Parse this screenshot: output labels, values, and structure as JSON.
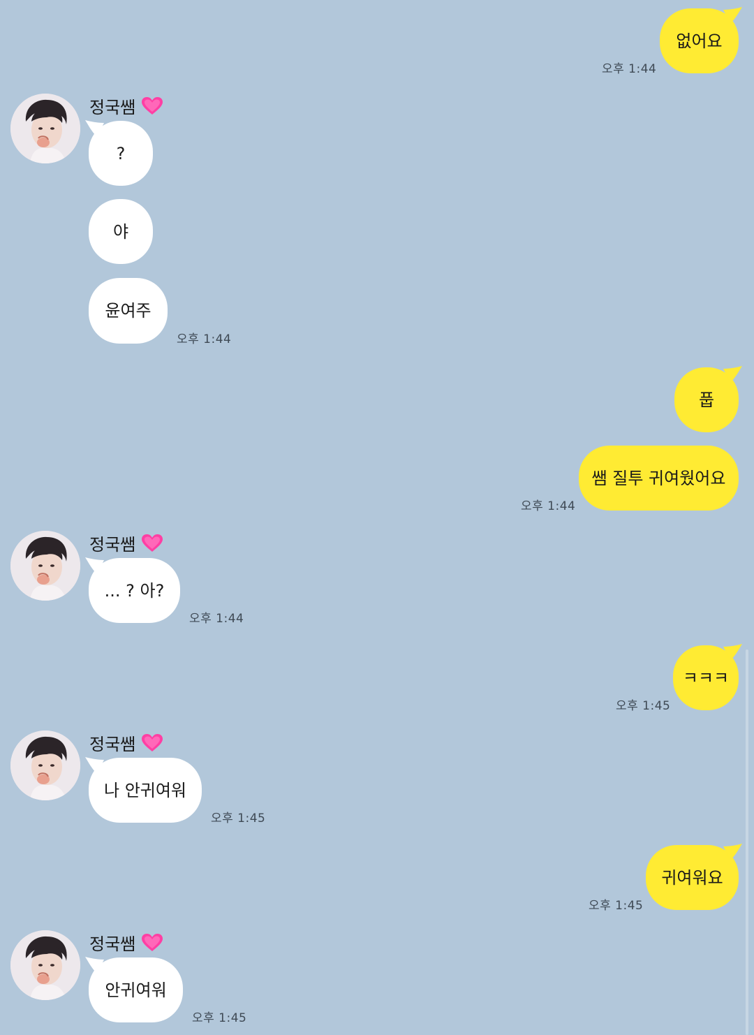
{
  "chat": {
    "contact_name": "정국쌤",
    "messages": [
      {
        "from": "me",
        "text": "없어요",
        "time": "오후 1:44"
      },
      {
        "from": "other",
        "text": "?"
      },
      {
        "from": "other",
        "text": "야"
      },
      {
        "from": "other",
        "text": "윤여주",
        "time": "오후 1:44"
      },
      {
        "from": "me",
        "text": "풉"
      },
      {
        "from": "me",
        "text": "쌤 질투 귀여웠어요",
        "time": "오후 1:44"
      },
      {
        "from": "other",
        "text": "... ? 아?",
        "time": "오후 1:44"
      },
      {
        "from": "me",
        "text": "ㅋㅋㅋ",
        "time": "오후 1:45"
      },
      {
        "from": "other",
        "text": "나 안귀여워",
        "time": "오후 1:45"
      },
      {
        "from": "me",
        "text": "귀여워요",
        "time": "오후 1:45"
      },
      {
        "from": "other",
        "text": "안귀여워",
        "time": "오후 1:45"
      }
    ]
  },
  "colors": {
    "background": "#b2c7da",
    "my_bubble": "#ffeb33",
    "their_bubble": "#ffffff",
    "heart": "#ff3fa4"
  },
  "icons": {
    "avatar": "profile-photo-avatar",
    "heart": "pink-heart-emoji-icon"
  }
}
